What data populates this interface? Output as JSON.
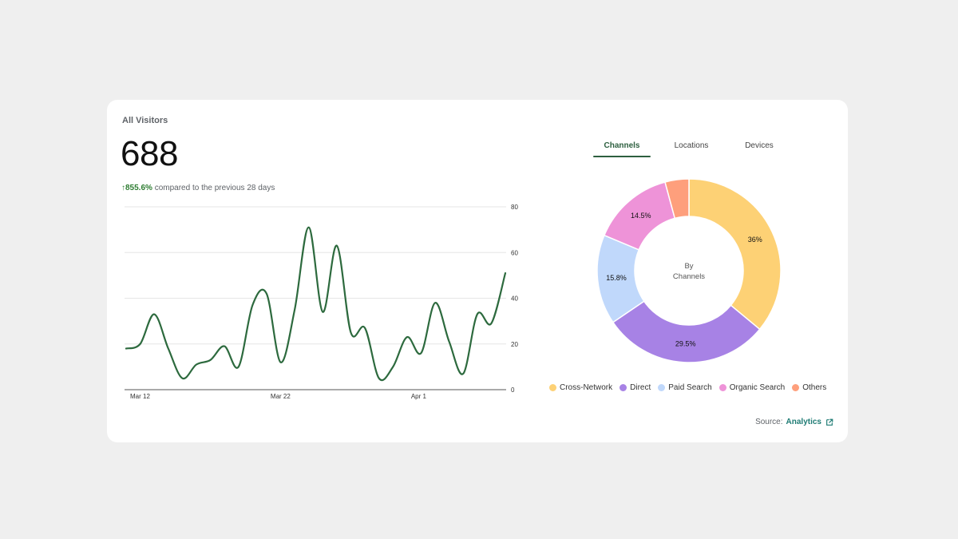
{
  "card": {
    "title": "All Visitors",
    "total": "688",
    "delta_value": "855.6%",
    "delta_text": "compared to the previous 28 days",
    "delta_arrow": "↑"
  },
  "tabs": [
    {
      "label": "Channels",
      "active": true
    },
    {
      "label": "Locations",
      "active": false
    },
    {
      "label": "Devices",
      "active": false
    }
  ],
  "chart_data": [
    {
      "type": "line",
      "title": "",
      "xlabel": "",
      "ylabel": "",
      "ylim": [
        0,
        80
      ],
      "yticks": [
        0,
        20,
        40,
        60,
        80
      ],
      "xticks": [
        {
          "label": "Mar 12",
          "index": 0
        },
        {
          "label": "Mar 22",
          "index": 10
        },
        {
          "label": "Apr 1",
          "index": 20
        }
      ],
      "grid": true,
      "color": "#2d6a3e",
      "series": [
        {
          "values": [
            18,
            20,
            33,
            18,
            5,
            11,
            13,
            19,
            10,
            37,
            42,
            12,
            35,
            71,
            34,
            63,
            25,
            27,
            5,
            10,
            23,
            16,
            38,
            21,
            7,
            33,
            29,
            51
          ]
        }
      ]
    },
    {
      "type": "pie",
      "donut": true,
      "center_label": [
        "By",
        "Channels"
      ],
      "slices": [
        {
          "name": "Cross-Network",
          "value": 36,
          "label": "36%",
          "color": "#fdd175"
        },
        {
          "name": "Direct",
          "value": 29.5,
          "label": "29.5%",
          "color": "#a782e5"
        },
        {
          "name": "Paid Search",
          "value": 15.8,
          "label": "15.8%",
          "color": "#c0d8fb"
        },
        {
          "name": "Organic Search",
          "value": 14.5,
          "label": "14.5%",
          "color": "#ee93d8"
        },
        {
          "name": "Others",
          "value": 4.2,
          "label": "",
          "color": "#fe9f7c"
        }
      ],
      "legend_position": "bottom"
    }
  ],
  "source": {
    "prefix": "Source:",
    "link": "Analytics",
    "icon": "external-link-icon"
  }
}
